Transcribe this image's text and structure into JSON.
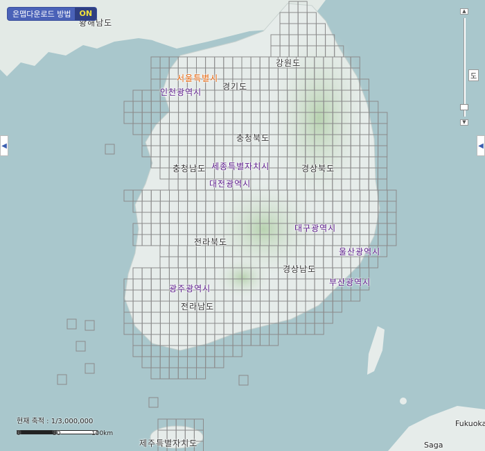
{
  "download_toggle": {
    "label": "온맵다운로드 방법",
    "state": "ON"
  },
  "zoom": {
    "level_fraction": 0.93,
    "tag_text": "도"
  },
  "scale": {
    "label": "현재 축적 : 1/3,000,000",
    "ticks": [
      "0",
      "50",
      "100km"
    ]
  },
  "regions": {
    "hwanghae": "황해남도",
    "seoul": "서울특별시",
    "incheon": "인천광역시",
    "gyeonggi": "경기도",
    "gangwon": "강원도",
    "chungbuk": "충청북도",
    "chungnam": "충청남도",
    "sejong": "세종특별자치시",
    "daejeon": "대전광역시",
    "gyeongbuk": "경상북도",
    "daegu": "대구광역시",
    "jeonbuk": "전라북도",
    "ulsan": "울산광역시",
    "gyeongnam": "경상남도",
    "busan": "부산광역시",
    "gwangju": "광주광역시",
    "jeonnam": "전라남도",
    "jeju": "제주특별자치도",
    "fukuoka": "Fukuoka",
    "saga": "Saga"
  },
  "colors": {
    "sea": "#a9c7cc",
    "land": "#e6ecea",
    "mountain": "#c9dcc4",
    "grid": "#8a8a8a",
    "metro_label": "#5a1a8a",
    "capital_label": "#e8650a"
  }
}
